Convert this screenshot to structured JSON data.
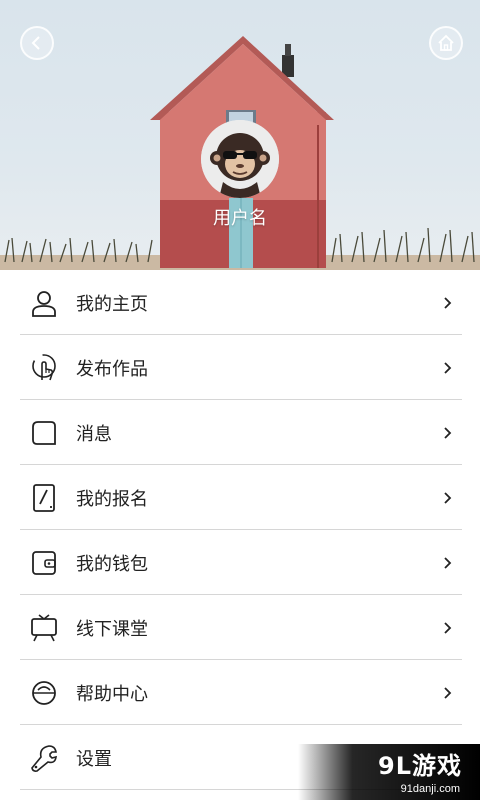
{
  "header": {
    "back_icon": "chevron-left-icon",
    "home_icon": "home-icon",
    "avatar_icon": "monkey-sunglasses-avatar",
    "username": "用户名"
  },
  "menu": [
    {
      "label": "我的主页",
      "icon": "user-icon"
    },
    {
      "label": "发布作品",
      "icon": "hand-pointer-icon"
    },
    {
      "label": "消息",
      "icon": "message-icon"
    },
    {
      "label": "我的报名",
      "icon": "signup-icon"
    },
    {
      "label": "我的钱包",
      "icon": "wallet-icon"
    },
    {
      "label": "线下课堂",
      "icon": "easel-icon"
    },
    {
      "label": "帮助中心",
      "icon": "help-icon"
    },
    {
      "label": "设置",
      "icon": "wrench-icon"
    }
  ],
  "watermark": {
    "logo": "9L游戏",
    "url": "91danji.com"
  },
  "colors": {
    "house": "#c96a66",
    "door": "#8fc7cf",
    "text": "#222222",
    "divider": "#d6d6d6"
  }
}
